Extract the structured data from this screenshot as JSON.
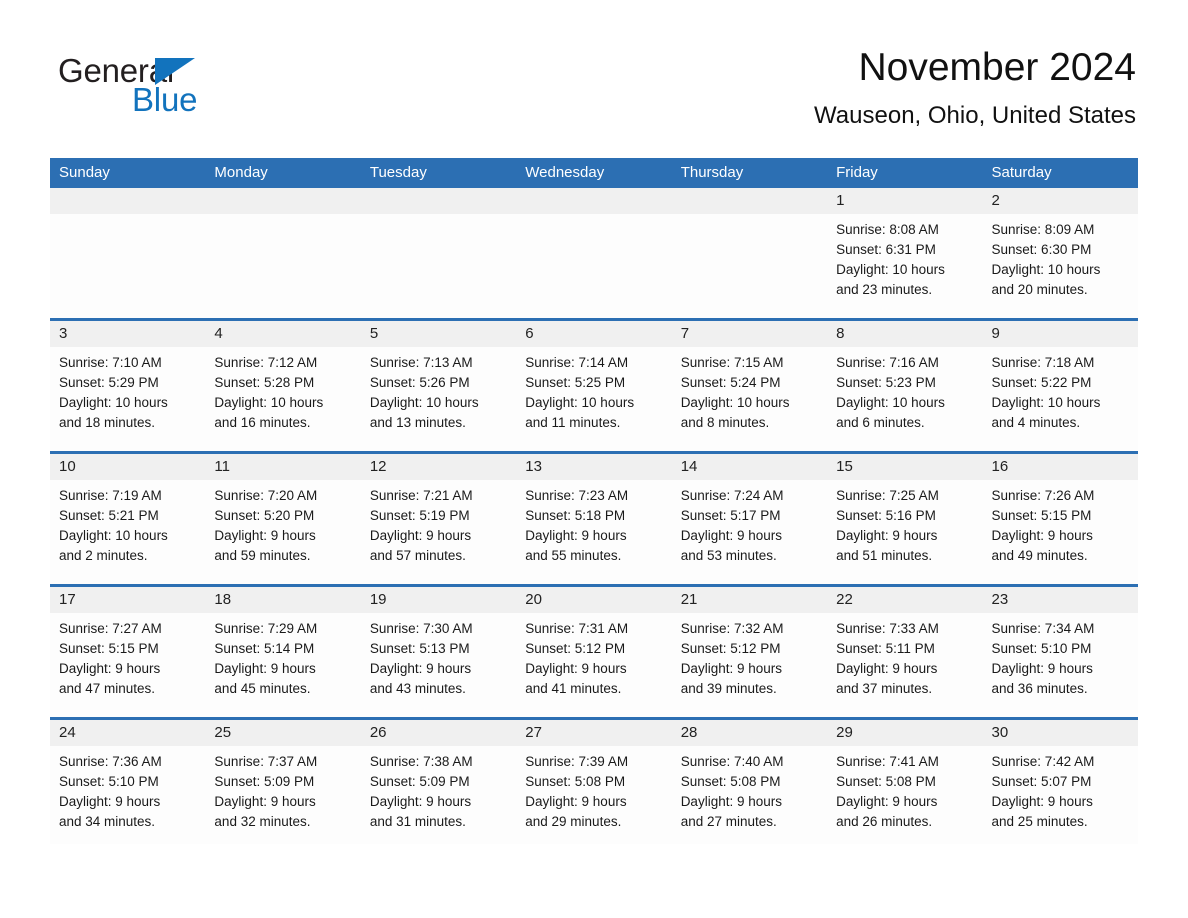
{
  "logo": {
    "word_black": "General",
    "word_blue": "Blue",
    "triangle_color": "#1273bd",
    "icon": "general-blue-logo"
  },
  "header": {
    "title": "November 2024",
    "subtitle": "Wauseon, Ohio, United States"
  },
  "colors": {
    "header_blue": "#2c6fb3",
    "row_separator": "#2c6fb3",
    "date_band": "#f0f0f0",
    "cell_background": "#fdfdfd",
    "text": "#1a1a1a"
  },
  "calendar": {
    "weekdays": [
      "Sunday",
      "Monday",
      "Tuesday",
      "Wednesday",
      "Thursday",
      "Friday",
      "Saturday"
    ],
    "weeks": [
      [
        {
          "day": "",
          "lines": []
        },
        {
          "day": "",
          "lines": []
        },
        {
          "day": "",
          "lines": []
        },
        {
          "day": "",
          "lines": []
        },
        {
          "day": "",
          "lines": []
        },
        {
          "day": "1",
          "lines": [
            "Sunrise: 8:08 AM",
            "Sunset: 6:31 PM",
            "Daylight: 10 hours",
            "and 23 minutes."
          ]
        },
        {
          "day": "2",
          "lines": [
            "Sunrise: 8:09 AM",
            "Sunset: 6:30 PM",
            "Daylight: 10 hours",
            "and 20 minutes."
          ]
        }
      ],
      [
        {
          "day": "3",
          "lines": [
            "Sunrise: 7:10 AM",
            "Sunset: 5:29 PM",
            "Daylight: 10 hours",
            "and 18 minutes."
          ]
        },
        {
          "day": "4",
          "lines": [
            "Sunrise: 7:12 AM",
            "Sunset: 5:28 PM",
            "Daylight: 10 hours",
            "and 16 minutes."
          ]
        },
        {
          "day": "5",
          "lines": [
            "Sunrise: 7:13 AM",
            "Sunset: 5:26 PM",
            "Daylight: 10 hours",
            "and 13 minutes."
          ]
        },
        {
          "day": "6",
          "lines": [
            "Sunrise: 7:14 AM",
            "Sunset: 5:25 PM",
            "Daylight: 10 hours",
            "and 11 minutes."
          ]
        },
        {
          "day": "7",
          "lines": [
            "Sunrise: 7:15 AM",
            "Sunset: 5:24 PM",
            "Daylight: 10 hours",
            "and 8 minutes."
          ]
        },
        {
          "day": "8",
          "lines": [
            "Sunrise: 7:16 AM",
            "Sunset: 5:23 PM",
            "Daylight: 10 hours",
            "and 6 minutes."
          ]
        },
        {
          "day": "9",
          "lines": [
            "Sunrise: 7:18 AM",
            "Sunset: 5:22 PM",
            "Daylight: 10 hours",
            "and 4 minutes."
          ]
        }
      ],
      [
        {
          "day": "10",
          "lines": [
            "Sunrise: 7:19 AM",
            "Sunset: 5:21 PM",
            "Daylight: 10 hours",
            "and 2 minutes."
          ]
        },
        {
          "day": "11",
          "lines": [
            "Sunrise: 7:20 AM",
            "Sunset: 5:20 PM",
            "Daylight: 9 hours",
            "and 59 minutes."
          ]
        },
        {
          "day": "12",
          "lines": [
            "Sunrise: 7:21 AM",
            "Sunset: 5:19 PM",
            "Daylight: 9 hours",
            "and 57 minutes."
          ]
        },
        {
          "day": "13",
          "lines": [
            "Sunrise: 7:23 AM",
            "Sunset: 5:18 PM",
            "Daylight: 9 hours",
            "and 55 minutes."
          ]
        },
        {
          "day": "14",
          "lines": [
            "Sunrise: 7:24 AM",
            "Sunset: 5:17 PM",
            "Daylight: 9 hours",
            "and 53 minutes."
          ]
        },
        {
          "day": "15",
          "lines": [
            "Sunrise: 7:25 AM",
            "Sunset: 5:16 PM",
            "Daylight: 9 hours",
            "and 51 minutes."
          ]
        },
        {
          "day": "16",
          "lines": [
            "Sunrise: 7:26 AM",
            "Sunset: 5:15 PM",
            "Daylight: 9 hours",
            "and 49 minutes."
          ]
        }
      ],
      [
        {
          "day": "17",
          "lines": [
            "Sunrise: 7:27 AM",
            "Sunset: 5:15 PM",
            "Daylight: 9 hours",
            "and 47 minutes."
          ]
        },
        {
          "day": "18",
          "lines": [
            "Sunrise: 7:29 AM",
            "Sunset: 5:14 PM",
            "Daylight: 9 hours",
            "and 45 minutes."
          ]
        },
        {
          "day": "19",
          "lines": [
            "Sunrise: 7:30 AM",
            "Sunset: 5:13 PM",
            "Daylight: 9 hours",
            "and 43 minutes."
          ]
        },
        {
          "day": "20",
          "lines": [
            "Sunrise: 7:31 AM",
            "Sunset: 5:12 PM",
            "Daylight: 9 hours",
            "and 41 minutes."
          ]
        },
        {
          "day": "21",
          "lines": [
            "Sunrise: 7:32 AM",
            "Sunset: 5:12 PM",
            "Daylight: 9 hours",
            "and 39 minutes."
          ]
        },
        {
          "day": "22",
          "lines": [
            "Sunrise: 7:33 AM",
            "Sunset: 5:11 PM",
            "Daylight: 9 hours",
            "and 37 minutes."
          ]
        },
        {
          "day": "23",
          "lines": [
            "Sunrise: 7:34 AM",
            "Sunset: 5:10 PM",
            "Daylight: 9 hours",
            "and 36 minutes."
          ]
        }
      ],
      [
        {
          "day": "24",
          "lines": [
            "Sunrise: 7:36 AM",
            "Sunset: 5:10 PM",
            "Daylight: 9 hours",
            "and 34 minutes."
          ]
        },
        {
          "day": "25",
          "lines": [
            "Sunrise: 7:37 AM",
            "Sunset: 5:09 PM",
            "Daylight: 9 hours",
            "and 32 minutes."
          ]
        },
        {
          "day": "26",
          "lines": [
            "Sunrise: 7:38 AM",
            "Sunset: 5:09 PM",
            "Daylight: 9 hours",
            "and 31 minutes."
          ]
        },
        {
          "day": "27",
          "lines": [
            "Sunrise: 7:39 AM",
            "Sunset: 5:08 PM",
            "Daylight: 9 hours",
            "and 29 minutes."
          ]
        },
        {
          "day": "28",
          "lines": [
            "Sunrise: 7:40 AM",
            "Sunset: 5:08 PM",
            "Daylight: 9 hours",
            "and 27 minutes."
          ]
        },
        {
          "day": "29",
          "lines": [
            "Sunrise: 7:41 AM",
            "Sunset: 5:08 PM",
            "Daylight: 9 hours",
            "and 26 minutes."
          ]
        },
        {
          "day": "30",
          "lines": [
            "Sunrise: 7:42 AM",
            "Sunset: 5:07 PM",
            "Daylight: 9 hours",
            "and 25 minutes."
          ]
        }
      ]
    ]
  }
}
